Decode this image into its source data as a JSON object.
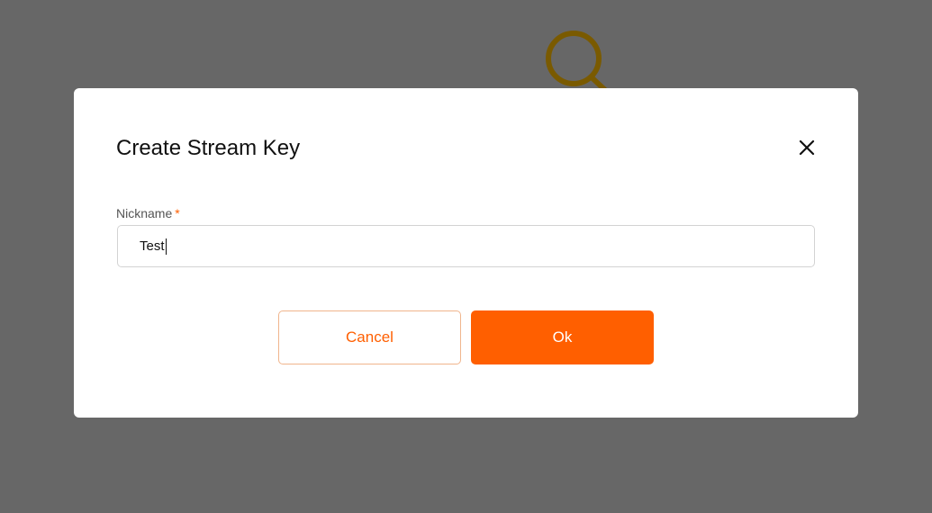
{
  "background": {
    "icon": "search-icon",
    "overlay_color": "#676767",
    "icon_color": "#7a5a00"
  },
  "dialog": {
    "title": "Create Stream Key",
    "close_icon": "close-icon",
    "nickname": {
      "label": "Nickname",
      "required_mark": "*",
      "value": "Test"
    },
    "buttons": {
      "cancel_label": "Cancel",
      "ok_label": "Ok"
    },
    "accent_color": "#ff5f00"
  }
}
